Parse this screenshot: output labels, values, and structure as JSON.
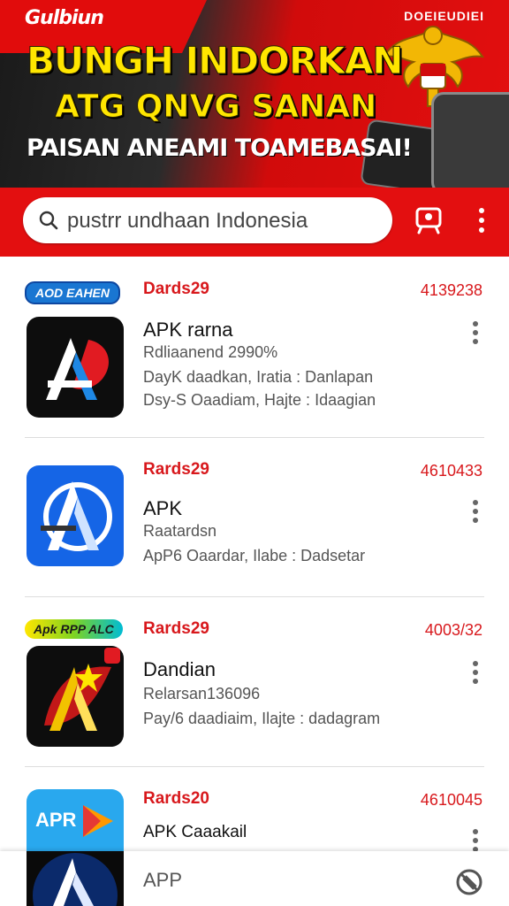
{
  "banner": {
    "brand": "Gulbiun",
    "corner_text": "DOEIEUDIEI",
    "headline": "BUNGH INDORKAN",
    "subhead": "ATG QNVG  SANAN",
    "tagline": "PAISAN ANEAMI TOAMEBASAI!"
  },
  "search": {
    "text": "pustrr undhaan Indonesia"
  },
  "items": [
    {
      "tag": "AOD EAHEN",
      "rank": "Dards29",
      "number": "4139238",
      "title": "APK rarna",
      "sub1": "Rdliaanend 2990%",
      "sub2": "DayK daadkan, Iratia : Danlapan",
      "sub3": "Dsy-S Oaadiam, Hajte : Idaagian"
    },
    {
      "tag": "",
      "rank": "Rards29",
      "number": "4610433",
      "title": "APK",
      "sub1": "Raatardsn",
      "sub2": "ApP6 Oaardar, Ilabe : Dadsetar"
    },
    {
      "tag": "Apk RPP ALC",
      "rank": "Rards29",
      "number": "4003/32",
      "title": "Dandian",
      "sub1": "Relarsan136096",
      "sub2": "Pay/6 daadiaim, Ilajte : dadagram"
    },
    {
      "tag": "",
      "rank": "Rards20",
      "number": "4610045",
      "title": "APK Caaakail",
      "icon_text": "APR"
    }
  ],
  "bottom": {
    "title": "APP"
  },
  "colors": {
    "brand_red": "#e30f10",
    "accent_yellow": "#ffe600",
    "rank_red": "#d8181c"
  }
}
